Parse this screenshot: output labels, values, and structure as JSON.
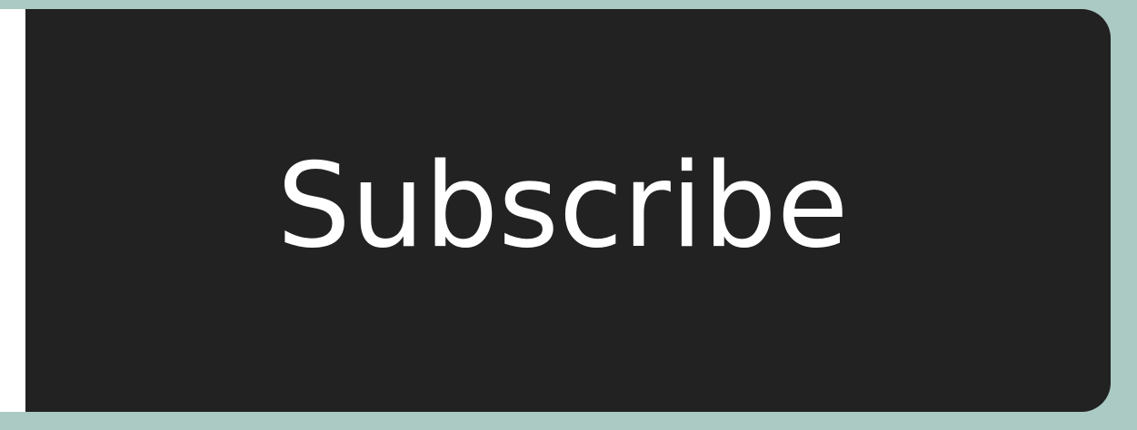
{
  "subscribe_form": {
    "email_input": {
      "value": "",
      "background": "#ffffff"
    },
    "subscribe_button": {
      "label": "Subscribe",
      "background": "#222222",
      "text_color": "#ffffff"
    },
    "page_background": "#accac4"
  }
}
